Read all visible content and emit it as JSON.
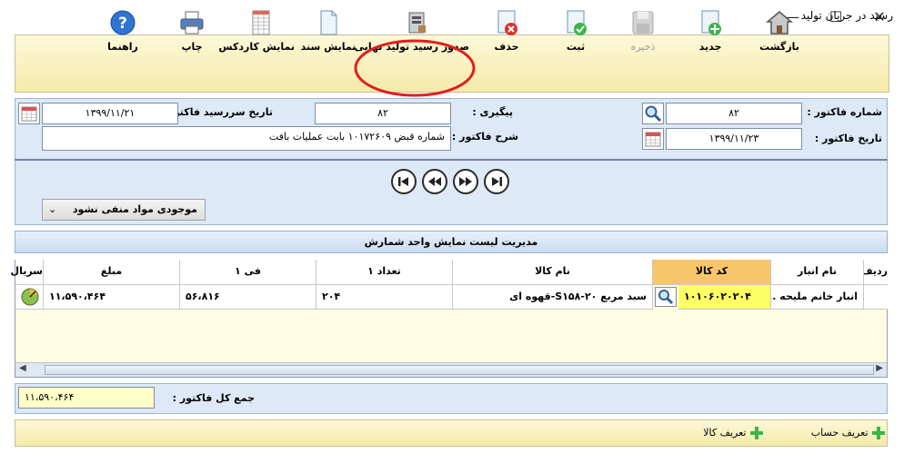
{
  "window": {
    "title": "رسید در جریان تولید",
    "minimize": "—",
    "maximize": "☐",
    "close": "✕"
  },
  "toolbar": {
    "items": [
      {
        "label": "بازگشت",
        "icon": "home-icon"
      },
      {
        "label": "جدید",
        "icon": "new-document-icon"
      },
      {
        "label": "ذخیره",
        "icon": "save-disk-icon",
        "disabled": true
      },
      {
        "label": "ثبت",
        "icon": "confirm-check-icon"
      },
      {
        "label": "حذف",
        "icon": "delete-document-icon"
      },
      {
        "label": "صدور رسید تولید نهایی",
        "icon": "issue-final-receipt-icon"
      },
      {
        "label": "نمایش سند",
        "icon": "document-icon"
      },
      {
        "label": "نمایش کاردکس",
        "icon": "cardex-sheet-icon"
      },
      {
        "label": "چاپ",
        "icon": "printer-icon"
      },
      {
        "label": "راهنما",
        "icon": "help-icon"
      }
    ]
  },
  "header": {
    "invoice_no_label": "شماره فاکتور :",
    "invoice_no": "۸۲",
    "invoice_date_label": "تاریخ فاکتور :",
    "invoice_date": "۱۳۹۹/۱۱/۲۳",
    "followup_label": "پیگیری :",
    "followup": "۸۲",
    "due_date_label": "تاریخ سررسید فاکتور :",
    "due_date": "۱۳۹۹/۱۱/۲۱",
    "description_label": "شرح فاکتور :",
    "description": "شماره قبض ۱۰۱۷۲۶۰۹ بابت  عملیات بافت",
    "stock_option": "موجودی مواد منفی نشود"
  },
  "grid": {
    "caption": "مدیریت لیست نمایش واحد شمارش",
    "columns": [
      "ردیف",
      "نام انبار",
      "کد کالا",
      "نام کالا",
      "تعداد ۱",
      "فی ۱",
      "مبلغ",
      "سریال"
    ],
    "rows": [
      {
        "warehouse": "انبار خانم ملیحه ...",
        "code": "۱۰۱۰۶۰۲۰۲۰۴",
        "name": "سبد مربع ۲۰-S۱۵۸-قهوه ای",
        "qty": "۲۰۴",
        "price": "۵۶،۸۱۶",
        "amount": "۱۱،۵۹۰،۴۶۴"
      }
    ]
  },
  "totals": {
    "label": "جمع کل فاکتور :",
    "value": "۱۱،۵۹۰،۴۶۴"
  },
  "footer": {
    "define_account": "تعریف حساب",
    "define_goods": "تعریف کالا"
  },
  "colors": {
    "toolbar_bg": "#f5eaa8",
    "panel_bg": "#dde9f6",
    "active_header": "#f7c56a",
    "highlight_cell": "#ffff66"
  }
}
